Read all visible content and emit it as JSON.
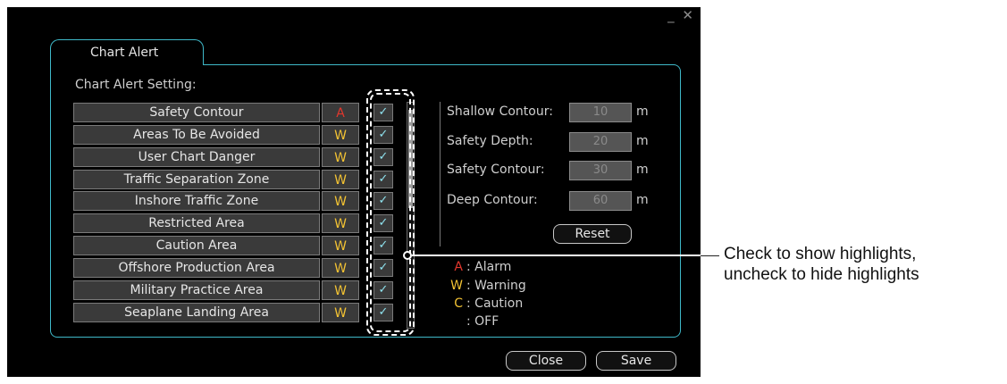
{
  "window": {
    "controls": "_ ✕"
  },
  "tab": {
    "label": "Chart Alert"
  },
  "section_title": "Chart Alert Setting:",
  "alert_rows": [
    {
      "name": "Safety Contour",
      "level": "A",
      "checked": "✓"
    },
    {
      "name": "Areas To Be Avoided",
      "level": "W",
      "checked": "✓"
    },
    {
      "name": "User Chart Danger",
      "level": "W",
      "checked": "✓"
    },
    {
      "name": "Traffic Separation Zone",
      "level": "W",
      "checked": "✓"
    },
    {
      "name": "Inshore Traffic Zone",
      "level": "W",
      "checked": "✓"
    },
    {
      "name": "Restricted Area",
      "level": "W",
      "checked": "✓"
    },
    {
      "name": "Caution Area",
      "level": "W",
      "checked": "✓"
    },
    {
      "name": "Offshore Production Area",
      "level": "W",
      "checked": "✓"
    },
    {
      "name": "Military Practice Area",
      "level": "W",
      "checked": "✓"
    },
    {
      "name": "Seaplane Landing Area",
      "level": "W",
      "checked": "✓"
    }
  ],
  "depth_fields": [
    {
      "label": "Shallow Contour:",
      "value": "10",
      "unit": "m"
    },
    {
      "label": "Safety Depth:",
      "value": "20",
      "unit": "m"
    },
    {
      "label": "Safety Contour:",
      "value": "30",
      "unit": "m"
    },
    {
      "label": "Deep Contour:",
      "value": "60",
      "unit": "m"
    }
  ],
  "reset_label": "Reset",
  "legend": [
    {
      "key": "A",
      "text": ": Alarm"
    },
    {
      "key": "W",
      "text": ": Warning"
    },
    {
      "key": "C",
      "text": ": Caution"
    },
    {
      "key": "",
      "text": ": OFF"
    }
  ],
  "buttons": {
    "close": "Close",
    "save": "Save"
  },
  "callout": {
    "line1": "Check to show highlights,",
    "line2": "uncheck to hide highlights"
  },
  "colors": {
    "accent": "#3fb9c9",
    "alarm": "#e2372d",
    "warning": "#f2c233",
    "check": "#8fe3ef"
  }
}
